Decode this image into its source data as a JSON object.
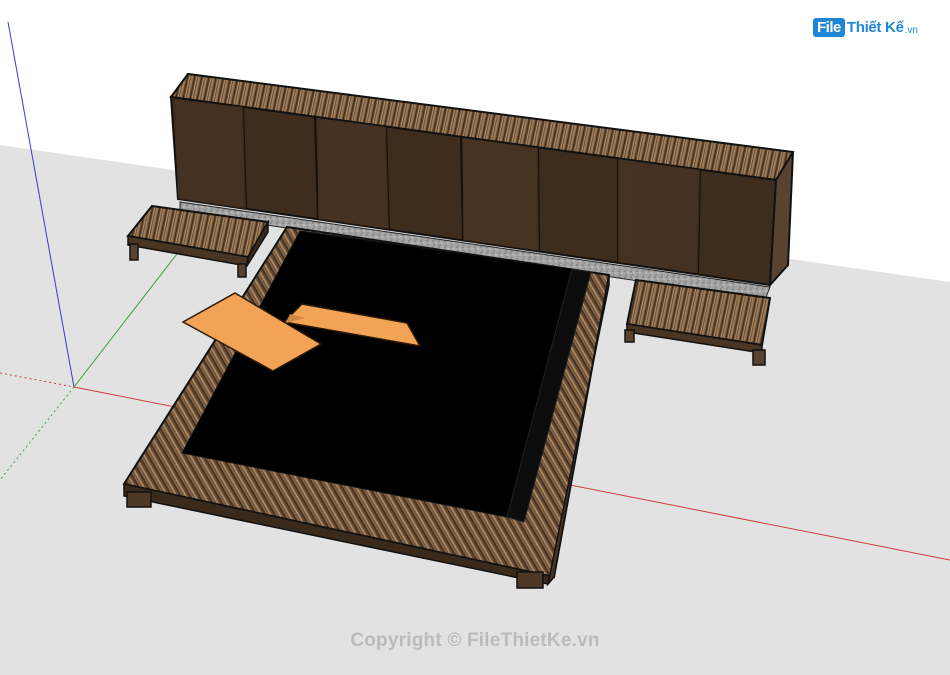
{
  "logo": {
    "file_label": "File",
    "brand_label": "Thiết Kế",
    "tld_label": ".vn"
  },
  "watermark": {
    "text": "Copyright © FileThietKe.vn"
  },
  "scene": {
    "subject": "bed-with-headboard-and-nightstands",
    "colors": {
      "ground": "#e3e3e3",
      "sky": "#ffffff",
      "wood_dark": "#3b2a1c",
      "wood_mid": "#6d5238",
      "wood_light": "#9a7b5a",
      "mattress": "#000000",
      "pillow": "#f2a356",
      "gravel": "#9a9a9a",
      "axis_red": "#d23a3a",
      "axis_green": "#3aa53a",
      "axis_blue": "#3a3ad2"
    }
  }
}
